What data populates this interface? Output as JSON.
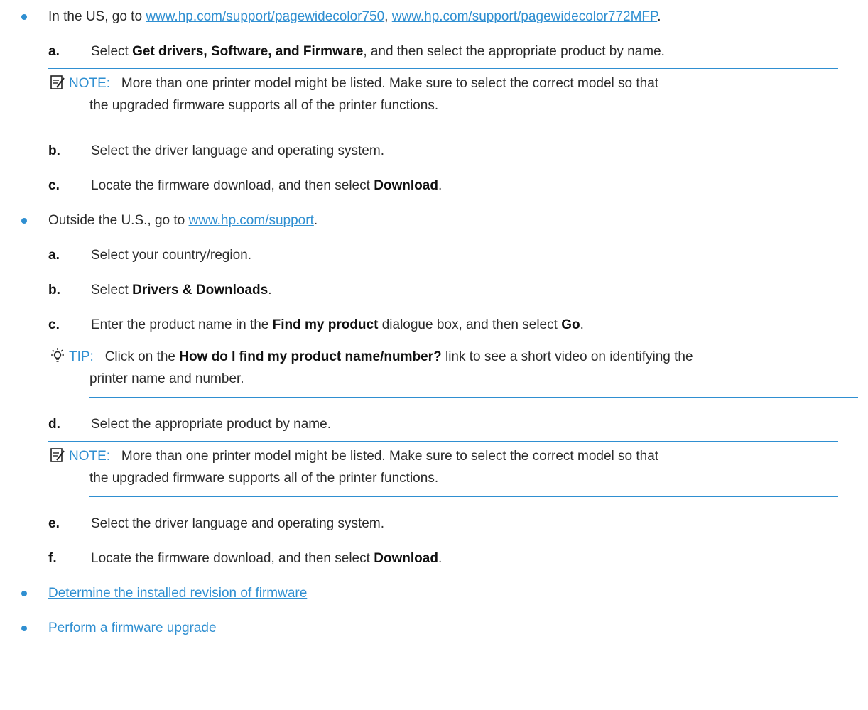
{
  "bullet1": {
    "prefix": "In the US, go to ",
    "link1": "www.hp.com/support/pagewidecolor750",
    "sep": ", ",
    "link2": "www.hp.com/support/pagewidecolor772MFP",
    "suffix": ".",
    "steps": [
      {
        "marker": "a.",
        "pre": "Select ",
        "bold": "Get drivers, Software, and Firmware",
        "post": ", and then select the appropriate product by name."
      },
      {
        "marker": "b.",
        "text": "Select the driver language and operating system."
      },
      {
        "marker": "c.",
        "pre": "Locate the firmware download, and then select ",
        "bold": "Download",
        "post": "."
      }
    ],
    "note": {
      "label": "NOTE:",
      "line1": "More than one printer model might be listed. Make sure to select the correct model so that",
      "line2": "the upgraded firmware supports all of the printer functions."
    }
  },
  "bullet2": {
    "prefix": "Outside the U.S., go to ",
    "link": "www.hp.com/support",
    "suffix": ".",
    "steps": [
      {
        "marker": "a.",
        "text": "Select your country/region."
      },
      {
        "marker": "b.",
        "pre": "Select ",
        "bold": "Drivers & Downloads",
        "post": "."
      },
      {
        "marker": "c.",
        "pre": "Enter the product name in the ",
        "bold": "Find my product",
        "mid": " dialogue box, and then select ",
        "bold2": "Go",
        "post": "."
      },
      {
        "marker": "d.",
        "text": "Select the appropriate product by name."
      },
      {
        "marker": "e.",
        "text": "Select the driver language and operating system."
      },
      {
        "marker": "f.",
        "pre": "Locate the firmware download, and then select ",
        "bold": "Download",
        "post": "."
      }
    ],
    "tip": {
      "label": "TIP:",
      "pre": "Click on the ",
      "bold": "How do I find my product name/number?",
      "post": " link to see a short video on identifying the",
      "line2": "printer name and number."
    },
    "note": {
      "label": "NOTE:",
      "line1": "More than one printer model might be listed. Make sure to select the correct model so that",
      "line2": "the upgraded firmware supports all of the printer functions."
    }
  },
  "related_links": [
    "Determine the installed revision of firmware",
    "Perform a firmware upgrade"
  ],
  "colors": {
    "accent": "#2f8fd1",
    "text": "#2b2b2b"
  }
}
